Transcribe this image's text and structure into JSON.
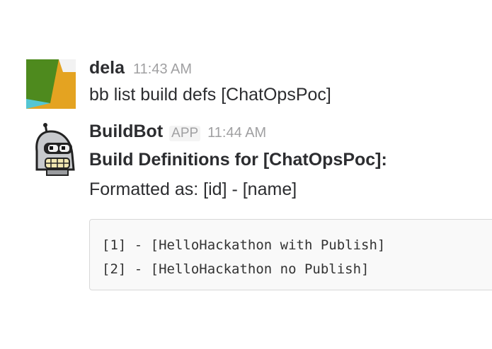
{
  "messages": [
    {
      "user": "dela",
      "time": "11:43 AM",
      "text": "bb list build defs [ChatOpsPoc]",
      "avatar": "multicolor-square-avatar"
    },
    {
      "user": "BuildBot",
      "badge": "APP",
      "time": "11:44 AM",
      "avatar": "robot-bender-avatar",
      "title": "Build Definitions for [ChatOpsPoc]:",
      "subtitle": "Formatted as: [id] - [name]",
      "code_lines": [
        "[1] - [HelloHackathon with Publish]",
        "[2] - [HelloHackathon no Publish]"
      ]
    }
  ],
  "colors": {
    "text": "#2c2d30",
    "muted": "#a0a0a2",
    "code_bg": "#f9f9f9",
    "code_border": "#d8d8d8",
    "avatar_green": "#4e8a1e",
    "avatar_orange": "#e4a321",
    "avatar_teal": "#54c6d3"
  }
}
